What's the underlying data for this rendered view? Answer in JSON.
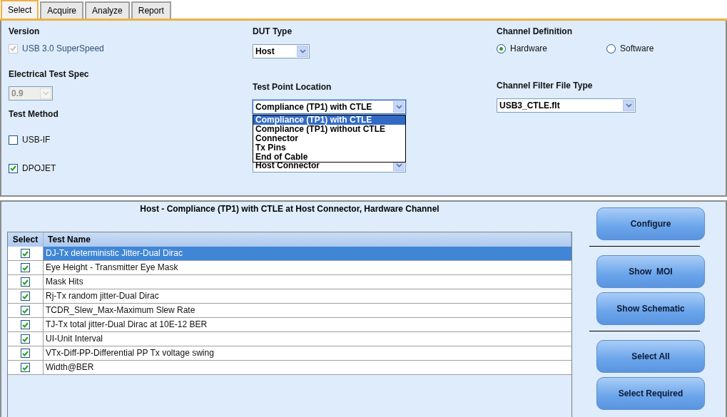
{
  "tabs": [
    {
      "label": "Select",
      "selected": true
    },
    {
      "label": "Acquire",
      "selected": false
    },
    {
      "label": "Analyze",
      "selected": false
    },
    {
      "label": "Report",
      "selected": false
    }
  ],
  "version": {
    "label": "Version",
    "option": {
      "label": "USB 3.0 SuperSpeed",
      "checked": true,
      "disabled": true
    }
  },
  "electrical_test_spec": {
    "label": "Electrical Test Spec",
    "value": "0.9",
    "disabled": true
  },
  "test_method": {
    "label": "Test Method",
    "options": [
      {
        "label": "USB-IF",
        "checked": false
      },
      {
        "label": "DPOJET",
        "checked": true
      }
    ]
  },
  "dut_type": {
    "label": "DUT Type",
    "value": "Host"
  },
  "test_point_location": {
    "label": "Test Point Location",
    "value": "Compliance (TP1) with CTLE",
    "expanded": true,
    "items": [
      {
        "label": "Compliance (TP1) with CTLE",
        "selected": true
      },
      {
        "label": "Compliance (TP1) without CTLE",
        "selected": false
      },
      {
        "label": "Connector",
        "selected": false
      },
      {
        "label": "Tx Pins",
        "selected": false
      },
      {
        "label": "End of Cable",
        "selected": false
      }
    ]
  },
  "location_select": {
    "value": "Host Connector"
  },
  "channel_definition": {
    "label": "Channel Definition",
    "options": [
      {
        "label": "Hardware",
        "selected": true
      },
      {
        "label": "Software",
        "selected": false
      }
    ]
  },
  "channel_filter_file_type": {
    "label": "Channel Filter File Type",
    "value": "USB3_CTLE.flt"
  },
  "test_list": {
    "title": "Host - Compliance (TP1) with CTLE at Host Connector, Hardware Channel",
    "columns": [
      "Select",
      "Test Name"
    ],
    "rows": [
      {
        "name": "DJ-Tx deterministic Jitter-Dual Dirac",
        "checked": true,
        "selected": true
      },
      {
        "name": "Eye Height - Transmitter Eye Mask",
        "checked": true,
        "selected": false
      },
      {
        "name": "Mask Hits",
        "checked": true,
        "selected": false
      },
      {
        "name": "Rj-Tx random jitter-Dual Dirac",
        "checked": true,
        "selected": false
      },
      {
        "name": "TCDR_Slew_Max-Maximum Slew Rate",
        "checked": true,
        "selected": false
      },
      {
        "name": "TJ-Tx total jitter-Dual Dirac at 10E-12 BER",
        "checked": true,
        "selected": false
      },
      {
        "name": "UI-Unit Interval",
        "checked": true,
        "selected": false
      },
      {
        "name": "VTx-Diff-PP-Differential PP Tx voltage swing",
        "checked": true,
        "selected": false
      },
      {
        "name": "Width@BER",
        "checked": true,
        "selected": false
      }
    ]
  },
  "button_groups": [
    [
      "Configure"
    ],
    [
      "Show  MOI",
      "Show Schematic"
    ],
    [
      "Select All",
      "Select Required"
    ]
  ]
}
